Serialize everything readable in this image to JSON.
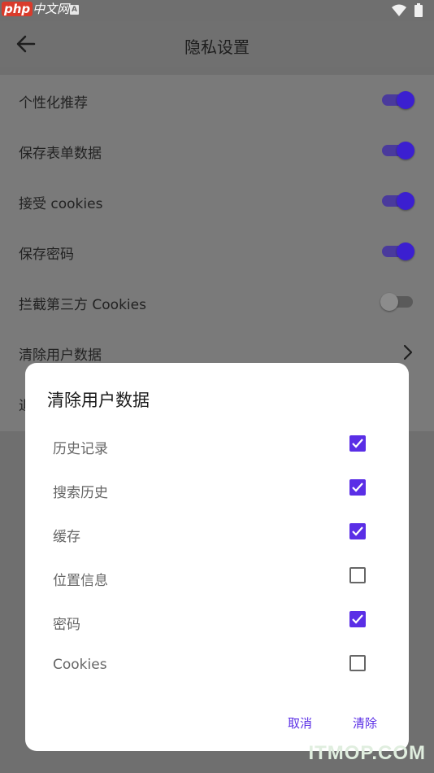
{
  "status_bar": {
    "watermark_logo": "php",
    "watermark_text": "中文网",
    "icons": [
      "sim-a-icon",
      "wifi-icon",
      "battery-icon"
    ]
  },
  "header": {
    "title": "隐私设置",
    "back_icon": "arrow-left-icon"
  },
  "settings": {
    "items": [
      {
        "label": "个性化推荐",
        "control": "switch",
        "state": "on"
      },
      {
        "label": "保存表单数据",
        "control": "switch",
        "state": "on"
      },
      {
        "label": "接受 cookies",
        "control": "switch",
        "state": "on"
      },
      {
        "label": "保存密码",
        "control": "switch",
        "state": "on"
      },
      {
        "label": "拦截第三方 Cookies",
        "control": "switch",
        "state": "off"
      },
      {
        "label": "清除用户数据",
        "control": "chevron"
      }
    ],
    "partial_item_fragment": "退"
  },
  "dialog": {
    "title": "清除用户数据",
    "options": [
      {
        "label": "历史记录",
        "checked": true
      },
      {
        "label": "搜索历史",
        "checked": true
      },
      {
        "label": "缓存",
        "checked": true
      },
      {
        "label": "位置信息",
        "checked": false
      },
      {
        "label": "密码",
        "checked": true
      },
      {
        "label": "Cookies",
        "checked": false
      }
    ],
    "cancel_label": "取消",
    "confirm_label": "清除"
  },
  "watermark_bottom": "ITMOP.COM",
  "colors": {
    "accent": "#5a2ee6",
    "scrim": "#6f6f6f",
    "dialog_bg": "#ffffff"
  }
}
